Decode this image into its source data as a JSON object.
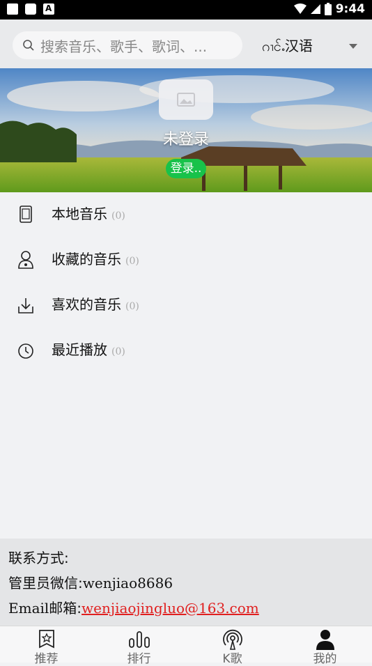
{
  "status_bar": {
    "time": "9:44"
  },
  "search": {
    "placeholder": "搜索音乐、歌手、歌词、..."
  },
  "language": {
    "selected": "ဂၢင်ႉ汉语"
  },
  "profile": {
    "name": "未登录",
    "login_label": "登录.."
  },
  "menu": [
    {
      "label": "本地音乐",
      "count": "(0)",
      "icon": "phone-icon"
    },
    {
      "label": "收藏的音乐",
      "count": "(0)",
      "icon": "user-icon"
    },
    {
      "label": "喜欢的音乐",
      "count": "(0)",
      "icon": "download-icon"
    },
    {
      "label": "最近播放",
      "count": "(0)",
      "icon": "clock-icon"
    }
  ],
  "contact": {
    "title": "联系方式:",
    "wechat_label": "管里员微信:",
    "wechat_value": "wenjiao8686",
    "email_label_en": "Email",
    "email_label_cn": "邮箱:",
    "email_value": "wenjiaojingluo@163.com"
  },
  "bottom_nav": [
    {
      "label": "推荐",
      "icon": "star-book-icon"
    },
    {
      "label": "排行",
      "icon": "bars-icon"
    },
    {
      "label": "K歌",
      "icon": "broadcast-icon"
    },
    {
      "label": "我的",
      "icon": "person-icon"
    }
  ],
  "colors": {
    "accent": "#18c24a",
    "link": "#e02020"
  }
}
